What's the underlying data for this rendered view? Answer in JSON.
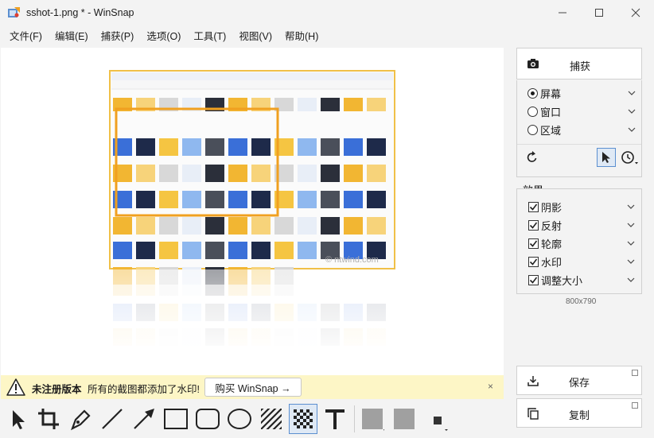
{
  "window": {
    "title": "sshot-1.png * - WinSnap"
  },
  "menu": [
    "文件(F)",
    "编辑(E)",
    "捕获(P)",
    "选项(O)",
    "工具(T)",
    "视图(V)",
    "帮助(H)"
  ],
  "preview": {
    "watermark": "© ntwind.com"
  },
  "banner": {
    "title": "未注册版本",
    "text": "所有的截图都添加了水印!",
    "buy_label": "购买 WinSnap →",
    "close": "×"
  },
  "toolbar": {
    "tools": [
      "select-tool",
      "crop-tool",
      "pen-tool",
      "line-tool",
      "arrow-tool",
      "rectangle-tool",
      "rounded-rectangle-tool",
      "ellipse-tool",
      "hatch-tool",
      "pixelate-tool",
      "text-tool",
      "fill-color",
      "outline-color",
      "line-width"
    ]
  },
  "panel": {
    "capture_label": "捕获",
    "modes": [
      {
        "label": "屏幕",
        "selected": true
      },
      {
        "label": "窗口",
        "selected": false
      },
      {
        "label": "区域",
        "selected": false
      }
    ],
    "effects_label": "效果",
    "effects": [
      {
        "label": "阴影",
        "checked": true
      },
      {
        "label": "反射",
        "checked": true
      },
      {
        "label": "轮廓",
        "checked": true
      },
      {
        "label": "水印",
        "checked": true
      },
      {
        "label": "调整大小",
        "checked": true
      }
    ],
    "size": "800x790",
    "save_label": "保存",
    "copy_label": "复制"
  },
  "colors": {
    "accent": "#f0a020",
    "banner": "#fdf6c6",
    "selection": "#5b8fd0"
  }
}
